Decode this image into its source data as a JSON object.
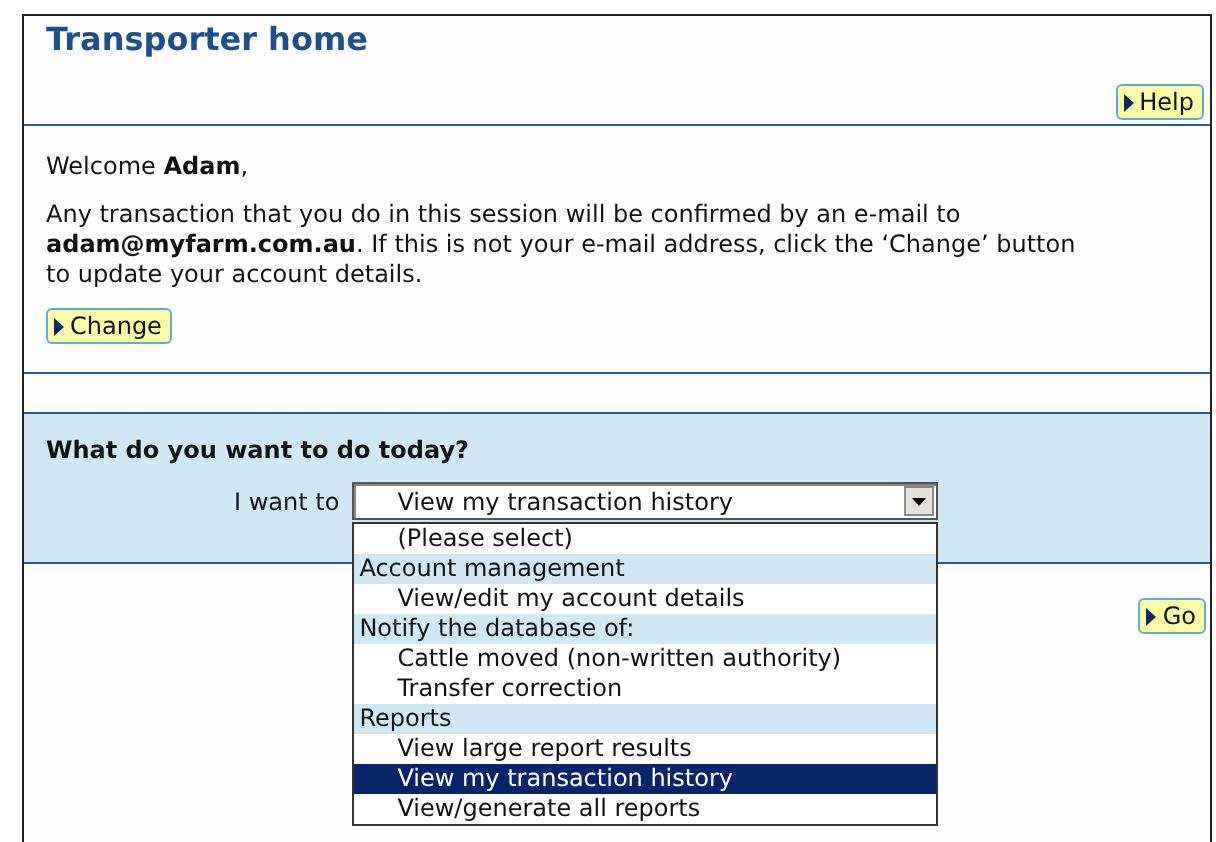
{
  "page": {
    "title": "Transporter home"
  },
  "help_button": {
    "label": "Help"
  },
  "welcome": {
    "greeting": "Welcome **Adam**,",
    "message": "Any transaction that you do in this session will be confirmed by an e-mail to **adam@myfarm.com.au**. If this is not your e-mail address, click the ‘Change’ button to update your account details."
  },
  "change_button": {
    "label": "Change"
  },
  "task": {
    "heading": "What do you want to do today?",
    "label": "I want to",
    "value": "View my transaction history",
    "expanded": true,
    "options": [
      {
        "kind": "option",
        "label": "(Please select)",
        "selected": false
      },
      {
        "kind": "group",
        "label": "Account management",
        "selected": false
      },
      {
        "kind": "option",
        "label": "View/edit my account details",
        "selected": false
      },
      {
        "kind": "group",
        "label": "Notify the database of:",
        "selected": false
      },
      {
        "kind": "option",
        "label": "Cattle moved (non-written authority)",
        "selected": false
      },
      {
        "kind": "option",
        "label": "Transfer correction",
        "selected": false
      },
      {
        "kind": "group",
        "label": "Reports",
        "selected": false
      },
      {
        "kind": "option",
        "label": "View large report results",
        "selected": false
      },
      {
        "kind": "option",
        "label": "View my transaction history",
        "selected": true
      },
      {
        "kind": "option",
        "label": "View/generate all reports",
        "selected": false
      }
    ]
  },
  "go_button": {
    "label": "Go"
  }
}
